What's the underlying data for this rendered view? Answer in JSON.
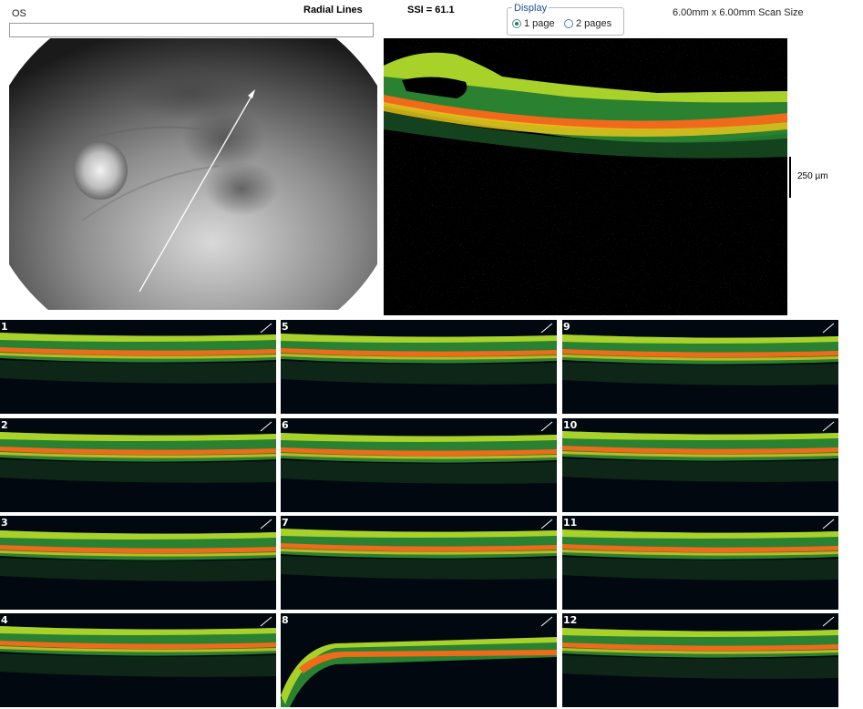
{
  "header": {
    "eye": "OS",
    "scan_type": "Radial Lines",
    "ssi": "SSI = 61.1",
    "scan_size": "6.00mm x 6.00mm Scan Size"
  },
  "display": {
    "legend": "Display",
    "options": [
      "1 page",
      "2 pages"
    ],
    "selected": "1 page"
  },
  "scale_bar": "250 µm",
  "thumbnails": [
    "1",
    "2",
    "3",
    "4",
    "5",
    "6",
    "7",
    "8",
    "9",
    "10",
    "11",
    "12"
  ],
  "colors": {
    "display_accent": "#1d4fa3",
    "radio_selected": "#1c8a2c"
  }
}
